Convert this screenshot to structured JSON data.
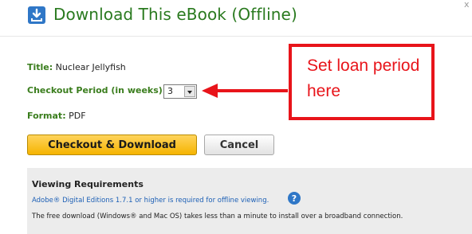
{
  "dialog": {
    "title": "Download This eBook (Offline)",
    "close_label": "x"
  },
  "details": {
    "title_label": "Title:",
    "title_value": "Nuclear Jellyfish",
    "period_label": "Checkout Period (in weeks):",
    "period_value": "3",
    "format_label": "Format:",
    "format_value": "PDF"
  },
  "buttons": {
    "checkout_label": "Checkout & Download",
    "cancel_label": "Cancel"
  },
  "requirements": {
    "heading": "Viewing Requirements",
    "link_text": "Adobe® Digital Editions 1.7.1 or higher is required for offline viewing.",
    "help_icon": "?",
    "note": "The free download (Windows® and Mac OS) takes less than a minute to install over a broadband connection."
  },
  "annotation": {
    "text": "Set loan period here",
    "color": "#e8141a"
  },
  "colors": {
    "label_green": "#3a7d1d",
    "title_green": "#2a7a1f",
    "checkout_gold": "#f5b400",
    "link_blue": "#1c5fb5",
    "icon_blue": "#2f77c7"
  },
  "icons": {
    "download": "download-icon",
    "help": "help-icon",
    "close": "close-icon",
    "dropdown": "chevron-down-icon",
    "arrow": "arrow-left-icon"
  }
}
